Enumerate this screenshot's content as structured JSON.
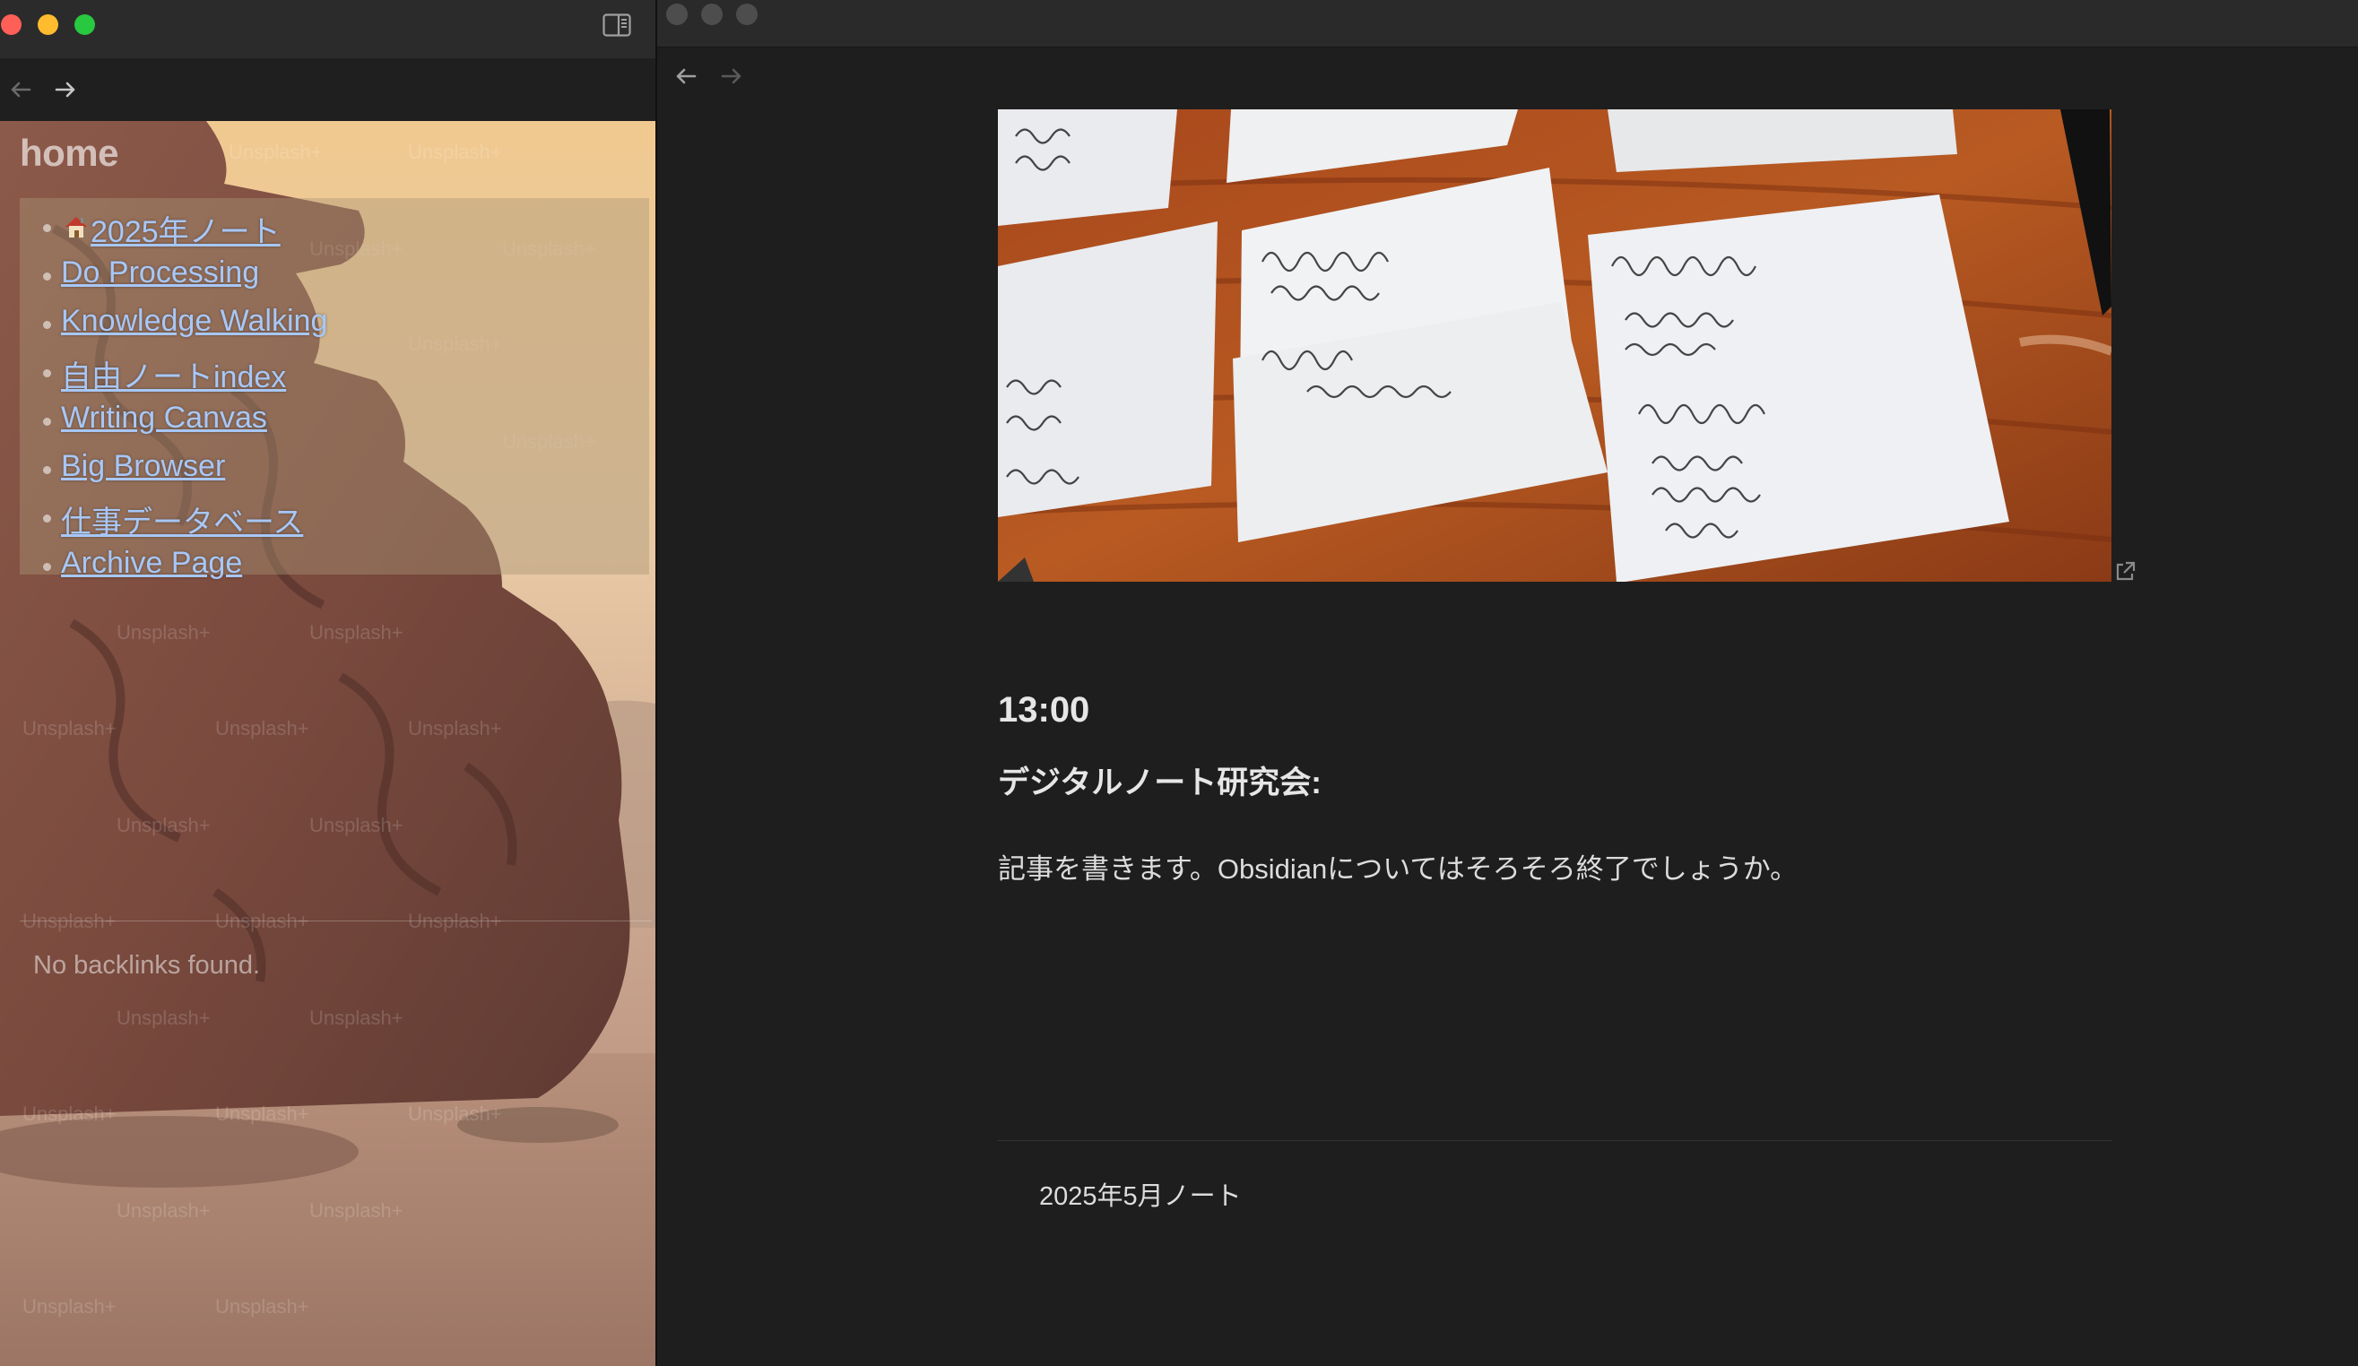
{
  "left_window": {
    "title": "home",
    "links": [
      {
        "label": "2025年ノート",
        "icon": "house-icon"
      },
      {
        "label": "Do Processing"
      },
      {
        "label": "Knowledge Walking"
      },
      {
        "label": "自由ノートindex"
      },
      {
        "label": "Writing Canvas"
      },
      {
        "label": "Big Browser"
      },
      {
        "label": "仕事データベース"
      },
      {
        "label": "Archive Page"
      }
    ],
    "backlinks_empty_text": "No backlinks found.",
    "wallpaper_watermark": "Unsplash+",
    "traffic_light_colors": {
      "close": "#fe5f57",
      "minimize": "#febc2e",
      "maximize": "#28c840"
    },
    "link_color": "#a7c7f7"
  },
  "right_window": {
    "time_heading": "13:00",
    "sub_heading": "デジタルノート研究会:",
    "body_text": "記事を書きます。Obsidianについてはそろそろ終了でしょうか。",
    "footer_link": "2025年5月ノート",
    "background_color": "#1e1e1e"
  }
}
